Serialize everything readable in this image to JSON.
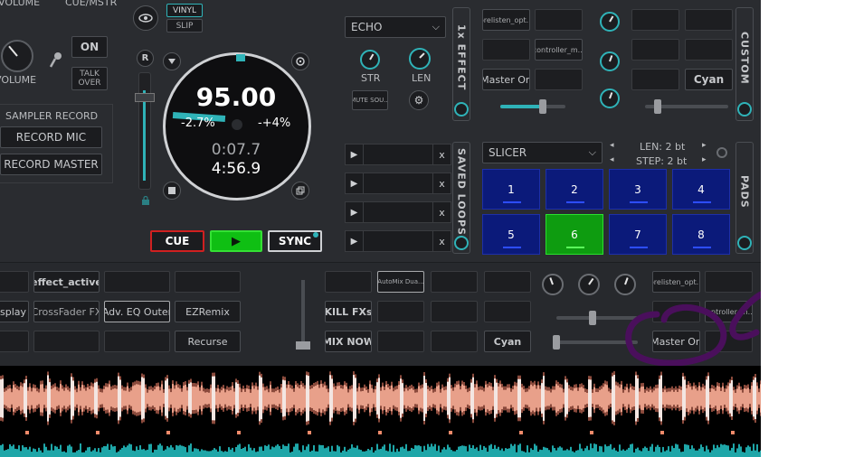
{
  "left": {
    "volume_top": "VOLUME",
    "cue_mstr": "CUE/MSTR",
    "volume": "VOLUME",
    "on": "ON",
    "talk_over": "TALK OVER",
    "sampler_record": "SAMPLER RECORD",
    "record_mic": "RECORD MIC",
    "record_master": "RECORD MASTER"
  },
  "deck": {
    "vinyl": "VINYL",
    "slip": "SLIP",
    "r_label": "R",
    "bpm": "95.00",
    "pitch_left": "-2.7%",
    "pitch_right": "-+4%",
    "time_elapsed": "0:07.7",
    "time_remaining": "4:56.9",
    "cue": "CUE",
    "play": "▶",
    "sync": "SYNC",
    "pitch_level": 0.3
  },
  "effect": {
    "name": "ECHO",
    "str": "STR",
    "len": "LEN",
    "mute_sound": "MUTE SOU...",
    "panel_label": "1x EFFECT"
  },
  "custom": {
    "panel_label": "CUSTOM",
    "prelisten": "prelisten_opt...",
    "controller": "controller_m...",
    "master_on": "Master On",
    "cyan": "Cyan",
    "slider_a_level": 0.65,
    "slider_b_level": 0.15
  },
  "loops": {
    "panel_label": "SAVED LOOPS",
    "play": "▶",
    "x": "x"
  },
  "pads": {
    "panel_label": "PADS",
    "mode": "SLICER",
    "len": "LEN: 2 bt",
    "step": "STEP: 2 bt",
    "prev": "◂",
    "next": "▸",
    "active_pad": 6,
    "labels": [
      "1",
      "2",
      "3",
      "4",
      "5",
      "6",
      "7",
      "8"
    ]
  },
  "bottom": {
    "effect_active": "effect_active",
    "display": "splay",
    "crossfader_fx": "CrossFader FX",
    "adv_eq_outer": "Adv. EQ Outer",
    "ezremix": "EZRemix",
    "recurse": "Recurse",
    "automix_dual": "AutoMix Dua...",
    "kill_fxs": "KILL FXs",
    "mix_now": "MIX NOW",
    "cyan": "Cyan",
    "prelisten": "prelisten_opt...",
    "controller": "controller_m...",
    "master_on": "Master On"
  },
  "colors": {
    "accent": "#2fb3b8",
    "play_green": "#0fbf13",
    "cue_red": "#d02020",
    "pad_blue": "#0b1a7a",
    "wave_peach": "#e8a08a",
    "wave_teal": "#1ea6a8"
  }
}
